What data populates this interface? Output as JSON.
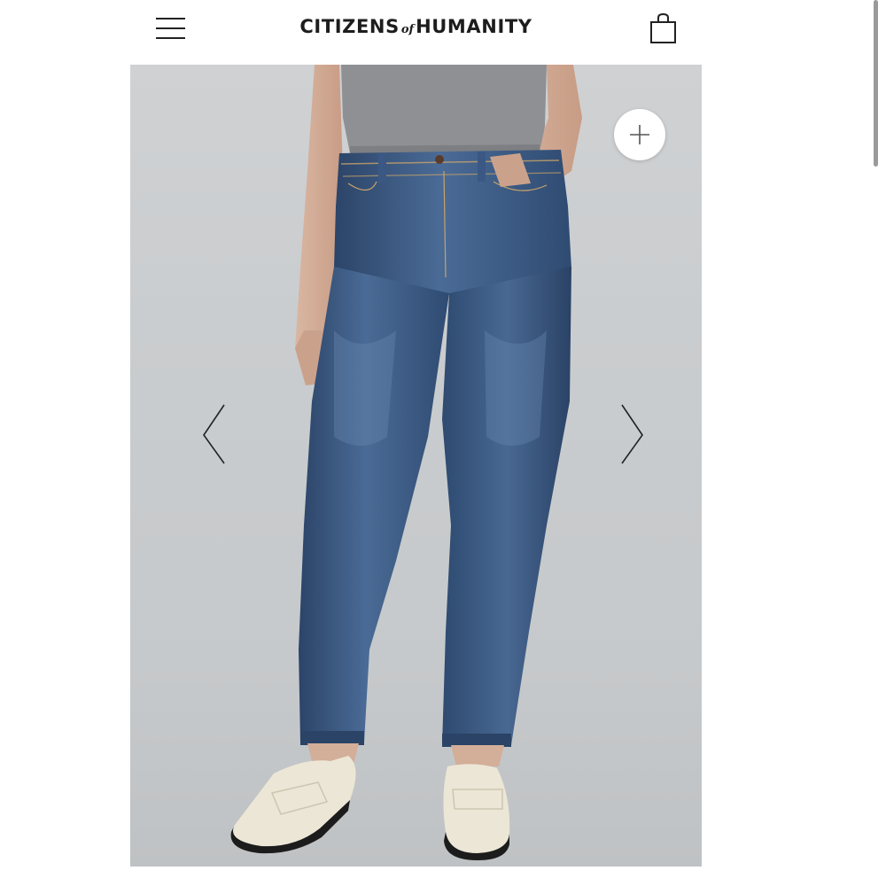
{
  "header": {
    "brand_part1": "CITIZENS",
    "brand_part2": "of",
    "brand_part3": "HUMANITY",
    "menu_icon": "hamburger-menu-icon",
    "cart_icon": "shopping-bag-icon"
  },
  "gallery": {
    "image_subject": "model wearing high-rise skinny jeans with grey t-shirt and cream loafers",
    "zoom_icon": "plus-icon",
    "prev_icon": "chevron-left-icon",
    "next_icon": "chevron-right-icon"
  },
  "colors": {
    "brand_text": "#1d1d1d",
    "background": "#ffffff",
    "photo_background": "#c9ccce",
    "denim": "#34517a",
    "tshirt": "#8c8e91",
    "loafer": "#ece6d6"
  }
}
